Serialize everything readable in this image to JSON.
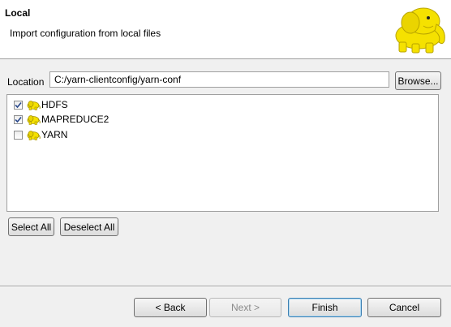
{
  "header": {
    "title": "Local",
    "subtitle": "Import configuration from local files"
  },
  "location": {
    "label": "Location",
    "value": "C:/yarn-clientconfig/yarn-conf",
    "browse_label": "Browse..."
  },
  "services": [
    {
      "label": "HDFS",
      "checked": true,
      "icon": "hadoop-elephant-icon"
    },
    {
      "label": "MAPREDUCE2",
      "checked": true,
      "icon": "hadoop-elephant-icon"
    },
    {
      "label": "YARN",
      "checked": false,
      "icon": "hadoop-elephant-icon"
    }
  ],
  "selection": {
    "select_all_label": "Select All",
    "deselect_all_label": "Deselect All"
  },
  "footer": {
    "back_label": "< Back",
    "next_label": "Next >",
    "finish_label": "Finish",
    "cancel_label": "Cancel"
  },
  "colors": {
    "elephant": "#f5e100",
    "header_bg": "#ffffff",
    "dialog_bg": "#f0f0f0"
  }
}
